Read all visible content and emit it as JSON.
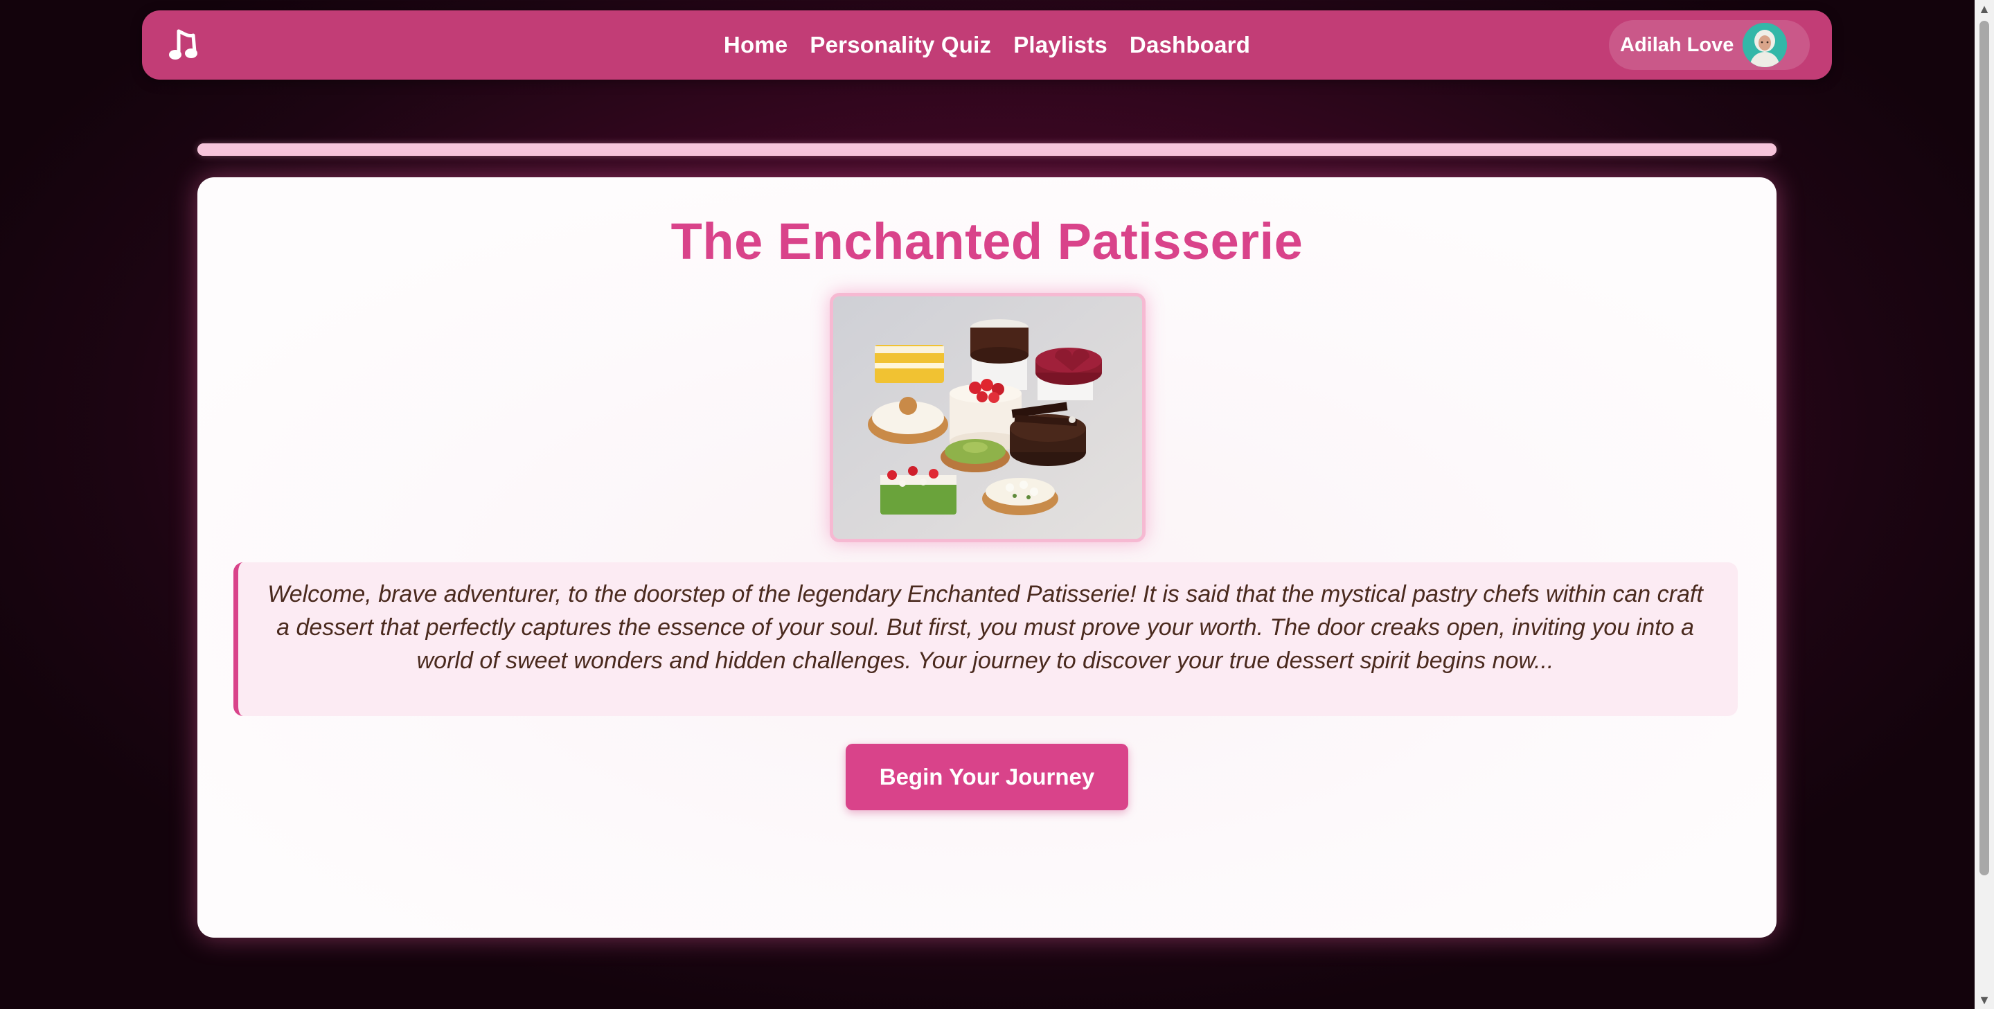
{
  "nav": {
    "logo_icon": "music-note-icon",
    "links": [
      {
        "label": "Home"
      },
      {
        "label": "Personality Quiz"
      },
      {
        "label": "Playlists"
      },
      {
        "label": "Dashboard"
      }
    ],
    "user": {
      "name": "Adilah Love",
      "avatar_icon": "user-avatar"
    }
  },
  "quiz": {
    "progress_fraction": 1.0
  },
  "card": {
    "title": "The Enchanted Patisserie",
    "image_icon": "pastry-assortment-image",
    "story": "Welcome, brave adventurer, to the doorstep of the legendary Enchanted Patisserie! It is said that the mystical pastry chefs within can craft a dessert that perfectly captures the essence of your soul. But first, you must prove your worth. The door creaks open, inviting you into a world of sweet wonders and hidden challenges. Your journey to discover your true dessert spirit begins now...",
    "button_label": "Begin Your Journey"
  },
  "colors": {
    "nav_bg": "#c23d76",
    "accent": "#d9438a",
    "progress": "#f7c6dc",
    "story_bg": "#fcebf3",
    "story_text": "#4a2a1e"
  }
}
